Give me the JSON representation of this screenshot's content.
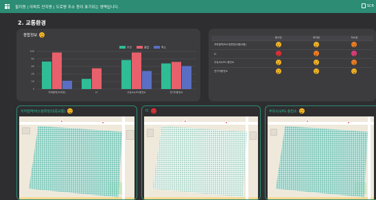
{
  "topbar": {
    "title": "필지명 | 아파트 단지명 | 도로명 주소 등이 표기되는 영역입니다.",
    "right_label": "SCR"
  },
  "section": {
    "title": "2. 교통환경"
  },
  "summary_card": {
    "title": "종합정보",
    "face": "yellow"
  },
  "chart_data": {
    "type": "bar",
    "legend": [
      "우군",
      "중립",
      "적소"
    ],
    "legend_position": "top-right",
    "categories": [
      "지하철역(도보권)",
      "IC",
      "주유소/LPG충전소",
      "전기차충전소"
    ],
    "series": [
      {
        "name": "우군",
        "color": "#2fbd96",
        "values": [
          73,
          27,
          77,
          68
        ]
      },
      {
        "name": "중립",
        "color": "#e8606b",
        "values": [
          97,
          55,
          97,
          72
        ]
      },
      {
        "name": "적소",
        "color": "#5a6fc4",
        "values": [
          22,
          0,
          48,
          61
        ]
      }
    ],
    "y_ticks": [
      "100",
      "80",
      "60",
      "40",
      "20",
      "0"
    ],
    "ylim": [
      0,
      100
    ],
    "grid": true
  },
  "table": {
    "columns": [
      "",
      "종사업",
      "위치점",
      "적소점"
    ],
    "rows": [
      {
        "label": "지하철역/버스정류장(대중교통)",
        "faces": [
          "yellow",
          "yellow",
          "orange"
        ]
      },
      {
        "label": "IC",
        "faces": [
          "red",
          "orange",
          "pink"
        ]
      },
      {
        "label": "주유소/LPG 충전소",
        "faces": [
          "yellow",
          "yellow",
          "orange"
        ]
      },
      {
        "label": "전기차충전소",
        "faces": [
          "yellow",
          "yellow",
          "yellow"
        ]
      }
    ]
  },
  "panels": [
    {
      "title": "지하철역/버스정류장(대중교통)",
      "face": "yellow"
    },
    {
      "title": "IC",
      "face": "red"
    },
    {
      "title": "주유소/LPG 충전소",
      "face": "yellow"
    }
  ],
  "colors": {
    "accent": "#2c8c74",
    "card": "#3c3c3f",
    "background": "#2e2e30"
  }
}
